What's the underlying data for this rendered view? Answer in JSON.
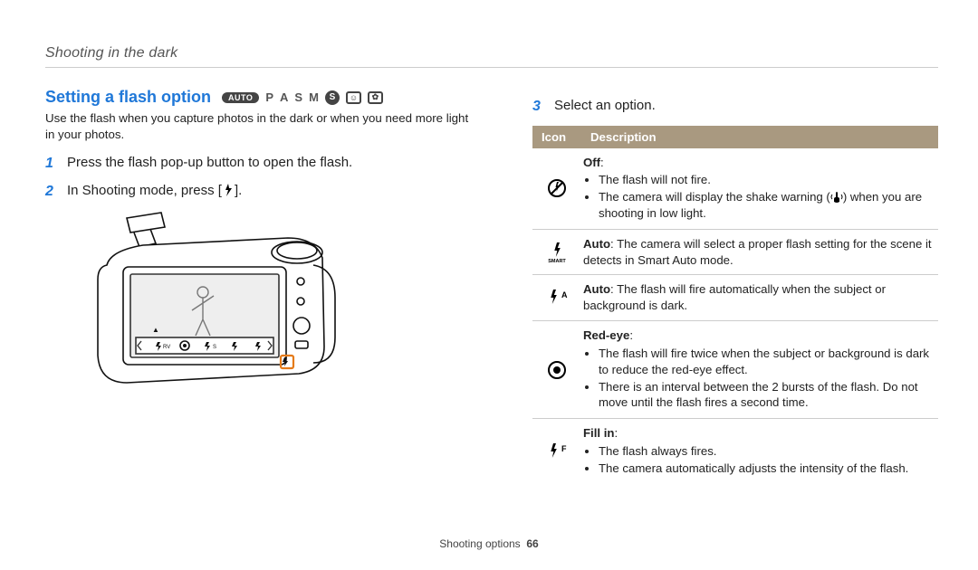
{
  "section": "Shooting in the dark",
  "heading": "Setting a flash option",
  "mode_icons": {
    "auto": "AUTO",
    "p": "P",
    "a": "A",
    "s": "S",
    "m": "M",
    "scene_s": "S",
    "scene_face": "☺",
    "scene_building": "✿"
  },
  "intro": "Use the flash when you capture photos in the dark or when you need more light in your photos.",
  "steps": {
    "1": "Press the flash pop-up button to open the flash.",
    "2_pre": "In Shooting mode, press [",
    "2_post": "].",
    "3": "Select an option."
  },
  "table": {
    "header_icon": "Icon",
    "header_desc": "Description",
    "rows": [
      {
        "icon": "off",
        "title": "Off",
        "bullets": [
          "The flash will not fire.",
          "The camera will display the shake warning (🖐) when you are shooting in low light."
        ]
      },
      {
        "icon": "smart",
        "title_inline": "Auto",
        "text": ": The camera will select a proper flash setting for the scene it detects in Smart Auto mode."
      },
      {
        "icon": "auto-a",
        "title_inline": "Auto",
        "text": ": The flash will fire automatically when the subject or background is dark."
      },
      {
        "icon": "redeye",
        "title": "Red-eye",
        "bullets": [
          "The flash will fire twice when the subject or background is dark to reduce the red-eye effect.",
          "There is an interval between the 2 bursts of the flash. Do not move until the flash fires a second time."
        ]
      },
      {
        "icon": "fillin",
        "title": "Fill in",
        "bullets": [
          "The flash always fires.",
          "The camera automatically adjusts the intensity of the flash."
        ]
      }
    ]
  },
  "footer": {
    "label": "Shooting options",
    "page": "66"
  }
}
